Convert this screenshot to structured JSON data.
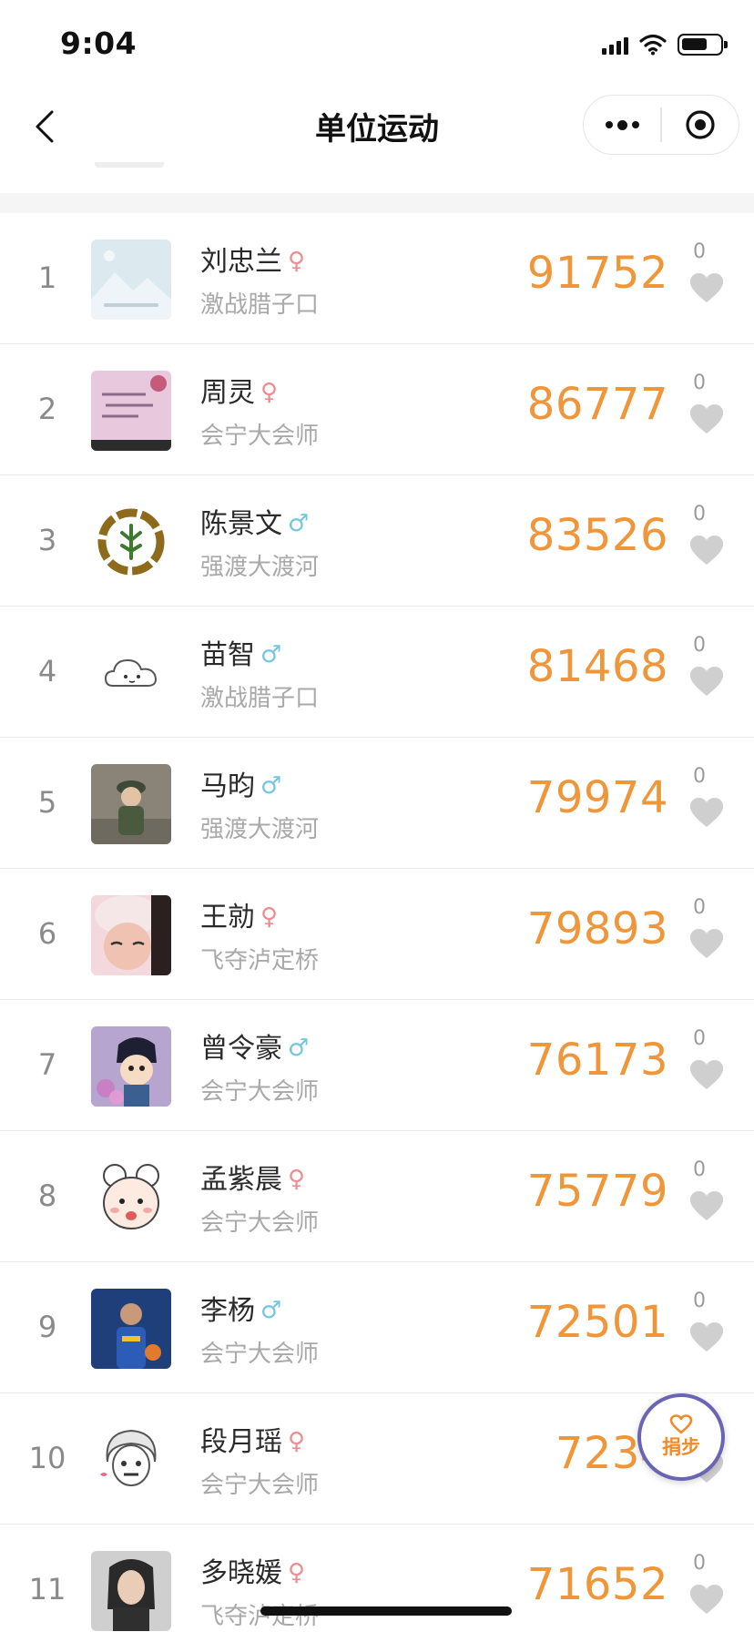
{
  "status_bar": {
    "time": "9:04"
  },
  "nav": {
    "title": "单位运动"
  },
  "colors": {
    "steps": "#f0963a",
    "female": "#e98f94",
    "male": "#74c6de",
    "donate_ring": "#6a64b5"
  },
  "ranking": [
    {
      "rank": "1",
      "name": "刘忠兰",
      "gender": "female",
      "gender_symbol": "♀",
      "team": "激战腊子口",
      "steps": "91752",
      "likes": "0",
      "avatar_icon": "placeholder-landscape"
    },
    {
      "rank": "2",
      "name": "周灵",
      "gender": "female",
      "gender_symbol": "♀",
      "team": "会宁大会师",
      "steps": "86777",
      "likes": "0",
      "avatar_icon": "handwritten-note"
    },
    {
      "rank": "3",
      "name": "陈景文",
      "gender": "male",
      "gender_symbol": "♂",
      "team": "强渡大渡河",
      "steps": "83526",
      "likes": "0",
      "avatar_icon": "circle-emblem"
    },
    {
      "rank": "4",
      "name": "苗智",
      "gender": "male",
      "gender_symbol": "♂",
      "team": "激战腊子口",
      "steps": "81468",
      "likes": "0",
      "avatar_icon": "cloud"
    },
    {
      "rank": "5",
      "name": "马昀",
      "gender": "male",
      "gender_symbol": "♂",
      "team": "强渡大渡河",
      "steps": "79974",
      "likes": "0",
      "avatar_icon": "child-photo"
    },
    {
      "rank": "6",
      "name": "王勍",
      "gender": "female",
      "gender_symbol": "♀",
      "team": "飞夺泸定桥",
      "steps": "79893",
      "likes": "0",
      "avatar_icon": "girl-photo"
    },
    {
      "rank": "7",
      "name": "曾令豪",
      "gender": "male",
      "gender_symbol": "♂",
      "team": "会宁大会师",
      "steps": "76173",
      "likes": "0",
      "avatar_icon": "anime-boy"
    },
    {
      "rank": "8",
      "name": "孟紫晨",
      "gender": "female",
      "gender_symbol": "♀",
      "team": "会宁大会师",
      "steps": "75779",
      "likes": "0",
      "avatar_icon": "cartoon-sheep"
    },
    {
      "rank": "9",
      "name": "李杨",
      "gender": "male",
      "gender_symbol": "♂",
      "team": "会宁大会师",
      "steps": "72501",
      "likes": "0",
      "avatar_icon": "basketball-player"
    },
    {
      "rank": "10",
      "name": "段月瑶",
      "gender": "female",
      "gender_symbol": "♀",
      "team": "会宁大会师",
      "steps": "7234",
      "likes": "",
      "avatar_icon": "cartoon-girl"
    },
    {
      "rank": "11",
      "name": "多晓媛",
      "gender": "female",
      "gender_symbol": "♀",
      "team": "飞夺泸定桥",
      "steps": "71652",
      "likes": "0",
      "avatar_icon": "illustrated-woman"
    }
  ],
  "donate": {
    "label": "捐步"
  }
}
